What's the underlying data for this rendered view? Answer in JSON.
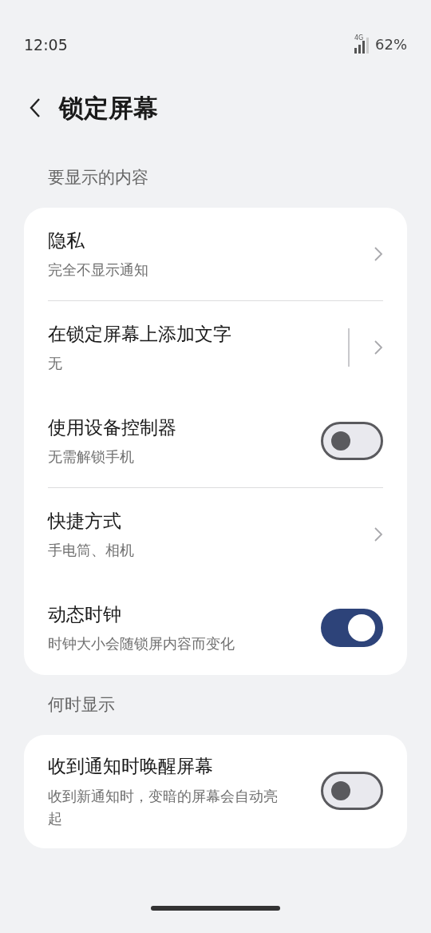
{
  "status_bar": {
    "time": "12:05",
    "network": "4G",
    "battery": "62%"
  },
  "header": {
    "title": "锁定屏幕"
  },
  "sections": [
    {
      "title": "要显示的内容",
      "items": [
        {
          "kind": "link",
          "title": "隐私",
          "subtitle": "完全不显示通知",
          "divider": true
        },
        {
          "kind": "split_link",
          "title": "在锁定屏幕上添加文字",
          "subtitle": "无",
          "divider": false
        },
        {
          "kind": "toggle",
          "title": "使用设备控制器",
          "subtitle": "无需解锁手机",
          "on": false,
          "divider": true
        },
        {
          "kind": "link",
          "title": "快捷方式",
          "subtitle": "手电筒、相机",
          "divider": false
        },
        {
          "kind": "toggle",
          "title": "动态时钟",
          "subtitle": "时钟大小会随锁屏内容而变化",
          "on": true,
          "divider": false
        }
      ]
    },
    {
      "title": "何时显示",
      "items": [
        {
          "kind": "toggle",
          "title": "收到通知时唤醒屏幕",
          "subtitle": "收到新通知时，变暗的屏幕会自动亮起",
          "on": false,
          "divider": false
        }
      ]
    }
  ]
}
